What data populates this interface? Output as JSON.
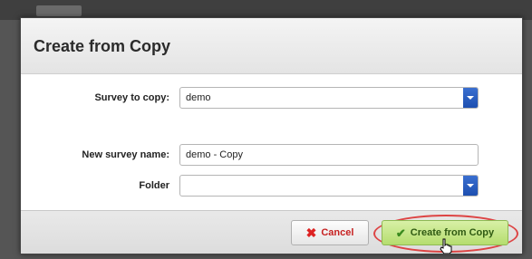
{
  "dialog": {
    "title": "Create from Copy",
    "survey_to_copy": {
      "label": "Survey to copy:",
      "value": "demo"
    },
    "new_survey_name": {
      "label": "New survey name:",
      "value": "demo - Copy"
    },
    "folder": {
      "label": "Folder",
      "value": ""
    }
  },
  "footer": {
    "cancel_label": "Cancel",
    "create_label": "Create from Copy",
    "cancel_icon": "x-icon",
    "create_icon": "checkmark-icon"
  },
  "colors": {
    "accent_blue": "#1d4fb0",
    "create_green": "#b5dd6f",
    "cancel_red": "#c62121",
    "highlight_ring": "#dd4444"
  }
}
